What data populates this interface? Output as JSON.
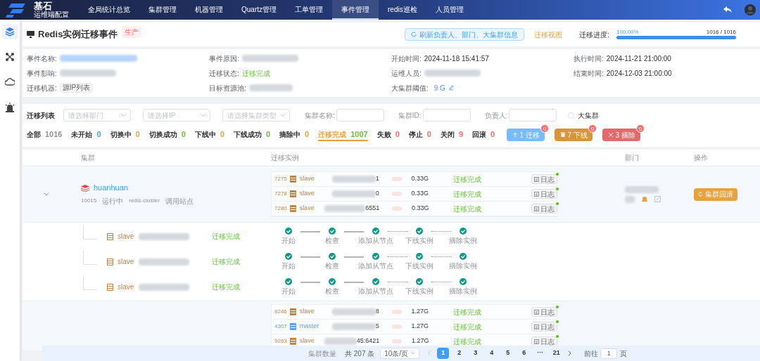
{
  "app": {
    "logo_title": "基石",
    "logo_subtitle": "运维端配置"
  },
  "nav": [
    {
      "label": "全局统计总览",
      "selected": false
    },
    {
      "label": "集群管理",
      "selected": false
    },
    {
      "label": "机器管理",
      "selected": false
    },
    {
      "label": "Quartz管理",
      "selected": false
    },
    {
      "label": "工单管理",
      "selected": false
    },
    {
      "label": "事件管理",
      "selected": true
    },
    {
      "label": "redis巡检",
      "selected": false
    },
    {
      "label": "人员管理",
      "selected": false
    }
  ],
  "sidebar": [
    {
      "kind": "layers",
      "selected": true
    },
    {
      "kind": "nodes",
      "selected": false
    },
    {
      "kind": "cloud",
      "selected": false
    },
    {
      "kind": "alarm",
      "selected": false
    }
  ],
  "header": {
    "title": "Redis实例迁移事件",
    "env_tag": "生产",
    "refresh_button": "刷新负责人、部门、大集群信息",
    "view_link": "迁移视图",
    "progress_label": "迁移进度:",
    "progress": {
      "level": 1,
      "percent": "100.00%",
      "count": "1016 / 1016"
    }
  },
  "info": [
    {
      "label": "事件名称:",
      "kind": "blurred-link"
    },
    {
      "label": "事件原因:",
      "kind": "blurred"
    },
    {
      "label": "开始时间:",
      "kind": "text",
      "value": "2024-11-18 15:41:57"
    },
    {
      "label": "执行时间:",
      "kind": "text",
      "value": "2024-11-21 21:00:00"
    },
    {
      "label": "事件影响:",
      "kind": "blurred"
    },
    {
      "label": "迁移状态:",
      "kind": "status",
      "value": "迁移完成"
    },
    {
      "label": "运维人员:",
      "kind": "blurred"
    },
    {
      "label": "结束时间:",
      "kind": "text",
      "value": "2024-12-03 21:00:00"
    },
    {
      "label": "迁移机器:",
      "kind": "tag",
      "value": "源IP列表"
    },
    {
      "label": "目标资源池:",
      "kind": "blurred"
    },
    {
      "label": "大集群阈值:",
      "kind": "editable",
      "value": "9 G"
    }
  ],
  "filters": {
    "title": "迁移列表",
    "selects": [
      "请选择部门",
      "请选择IP",
      "请选择集群类型"
    ],
    "inputs": [
      "集群名称:",
      "集群ID:",
      "负责人:"
    ],
    "checkbox": {
      "label": "大集群",
      "checked": false
    }
  },
  "status_tabs": [
    {
      "label": "全部",
      "count": "1016",
      "color": "#909399",
      "selected": false
    },
    {
      "label": "未开始",
      "count": "0",
      "color": "#409eff",
      "selected": false
    },
    {
      "label": "切换中",
      "count": "0",
      "color": "#e6a23c",
      "selected": false
    },
    {
      "label": "切换成功",
      "count": "0",
      "color": "#67c23a",
      "selected": false
    },
    {
      "label": "下线中",
      "count": "0",
      "color": "#e6a23c",
      "selected": false
    },
    {
      "label": "下线成功",
      "count": "0",
      "color": "#67c23a",
      "selected": false
    },
    {
      "label": "摘除中",
      "count": "0",
      "color": "#e6a23c",
      "selected": false
    },
    {
      "label": "迁移完成",
      "count": "1007",
      "color": "#67c23a",
      "selected": true
    },
    {
      "label": "失败",
      "count": "0",
      "color": "#f56c6c",
      "selected": false
    },
    {
      "label": "停止",
      "count": "0",
      "color": "#f56c6c",
      "selected": false
    },
    {
      "label": "关闭",
      "count": "9",
      "color": "#f56c6c",
      "selected": false
    },
    {
      "label": "回滚",
      "count": "0",
      "color": "#f56c6c",
      "selected": false
    }
  ],
  "actions": [
    {
      "kind": "migrate",
      "label": "1 迁移",
      "badge": "0",
      "disabled": true
    },
    {
      "kind": "offline",
      "label": "7 下线",
      "badge": "0",
      "disabled": true
    },
    {
      "kind": "remove",
      "label": "3 摘除",
      "badge": "0",
      "disabled": true
    }
  ],
  "table": {
    "columns": [
      "集群",
      "迁移实例",
      "部门",
      "操作"
    ],
    "clusters": [
      {
        "name": "huanhuan",
        "id": "10015",
        "state": "运行中",
        "type": "redis-cluster",
        "site": "调用站点",
        "expanded": true,
        "action": "集群回滚",
        "instances": [
          {
            "port": "7275",
            "role": "slave",
            "color": "#b8864b",
            "ip_tail": "1",
            "size": "0.33G",
            "status": "迁移完成",
            "log": "日志"
          },
          {
            "port": "7278",
            "role": "slave",
            "color": "#b8864b",
            "ip_tail": "0",
            "size": "0.33G",
            "status": "迁移完成",
            "log": "日志"
          },
          {
            "port": "7280",
            "role": "slave",
            "color": "#b8864b",
            "ip_tail": "6551",
            "size": "0.33G",
            "status": "迁移完成",
            "log": "日志"
          }
        ],
        "children": [
          {
            "role": "slave",
            "status": "迁移完成",
            "steps": [
              {
                "label": "开始",
                "done": true
              },
              {
                "label": "检查",
                "done": true,
                "dashed": false
              },
              {
                "label": "添加从节点",
                "done": true,
                "dashed": false
              },
              {
                "label": "下线实例",
                "done": true,
                "dashed": true
              },
              {
                "label": "摘除实例",
                "done": true,
                "dashed": true
              }
            ]
          },
          {
            "role": "slave",
            "status": "迁移完成",
            "steps": [
              {
                "label": "开始",
                "done": true
              },
              {
                "label": "检查",
                "done": true,
                "dashed": false
              },
              {
                "label": "添加从节点",
                "done": true,
                "dashed": false
              },
              {
                "label": "下线实例",
                "done": true,
                "dashed": true
              },
              {
                "label": "摘除实例",
                "done": true,
                "dashed": true
              }
            ]
          },
          {
            "role": "slave",
            "status": "迁移完成",
            "steps": [
              {
                "label": "开始",
                "done": true
              },
              {
                "label": "检查",
                "done": true,
                "dashed": false
              },
              {
                "label": "添加从节点",
                "done": true,
                "dashed": false
              },
              {
                "label": "下线实例",
                "done": true,
                "dashed": true
              },
              {
                "label": "摘除实例",
                "done": true,
                "dashed": true
              }
            ]
          }
        ]
      },
      {
        "instances": [
          {
            "port": "9246",
            "role": "slave",
            "color": "#b8864b",
            "ip_tail": "8",
            "size": "1.27G",
            "status": "迁移完成",
            "log": "日志"
          },
          {
            "port": "4307",
            "role": "master",
            "color": "#5b9bf0",
            "ip_tail": "5",
            "size": "1.27G",
            "status": "迁移完成",
            "log": "日志"
          },
          {
            "port": "9263",
            "role": "slave",
            "color": "#b8864b",
            "ip_tail": "45:6421",
            "size": "1.27G",
            "status": "迁移完成",
            "log": "日志"
          }
        ]
      }
    ]
  },
  "pagination": {
    "total_label": "集群数量",
    "total": "共 207 条",
    "page_size": "10条/页",
    "pages": [
      {
        "label": "1",
        "selected": true
      },
      {
        "label": "2",
        "selected": false
      },
      {
        "label": "3",
        "selected": false
      },
      {
        "label": "4",
        "selected": false
      },
      {
        "label": "5",
        "selected": false
      },
      {
        "label": "6",
        "selected": false
      },
      {
        "label": "···",
        "selected": false
      },
      {
        "label": "21",
        "selected": false
      }
    ],
    "jump_label": "前往",
    "jump_value": "1",
    "jump_suffix": "页"
  }
}
